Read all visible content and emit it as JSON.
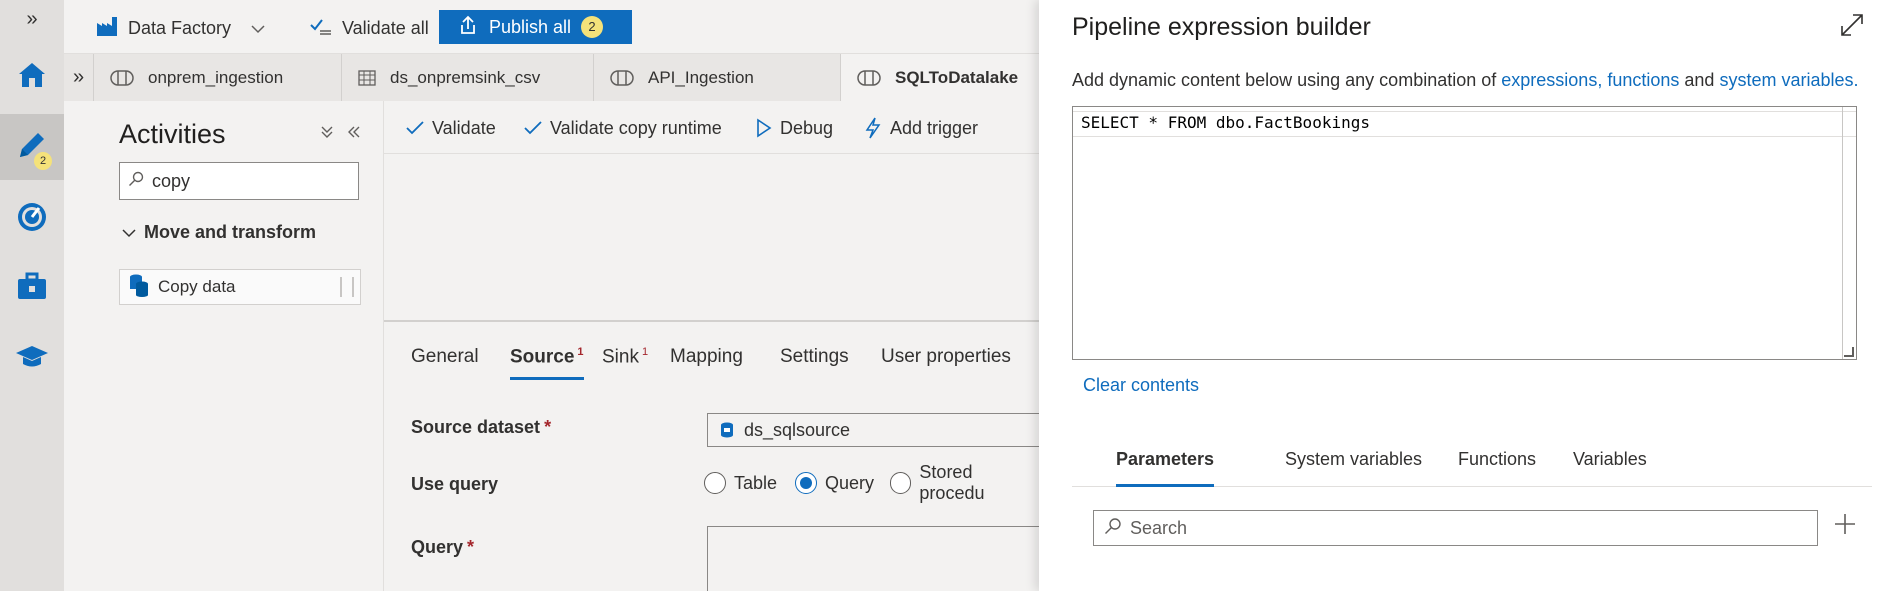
{
  "rail": {
    "expand_glyph": "»",
    "items": [
      {
        "icon": "home-icon"
      },
      {
        "icon": "pencil-author-icon",
        "badge": "2"
      },
      {
        "icon": "monitor-gauge-icon"
      },
      {
        "icon": "toolbox-manage-icon"
      },
      {
        "icon": "learning-cap-icon"
      }
    ]
  },
  "toolbar": {
    "factory_label": "Data Factory",
    "validate_all_label": "Validate all",
    "publish_all_label": "Publish all",
    "publish_count": "2"
  },
  "file_tabs": {
    "collapse_glyph": "»",
    "tabs": [
      {
        "label": "onprem_ingestion",
        "icon": "pipeline-icon"
      },
      {
        "label": "ds_onpremsink_csv",
        "icon": "table-dataset-icon"
      },
      {
        "label": "API_Ingestion",
        "icon": "pipeline-icon"
      },
      {
        "label": "SQLToDatalake",
        "icon": "pipeline-icon",
        "active": true
      }
    ]
  },
  "activities": {
    "title": "Activities",
    "search_value": "copy",
    "group_label": "Move and transform",
    "item_label": "Copy data"
  },
  "commands": {
    "validate": "Validate",
    "validate_copy_runtime": "Validate copy runtime",
    "debug": "Debug",
    "add_trigger": "Add trigger"
  },
  "properties": {
    "tabs": [
      {
        "label": "General"
      },
      {
        "label": "Source",
        "marker": "1",
        "active": true
      },
      {
        "label": "Sink",
        "marker": "1"
      },
      {
        "label": "Mapping"
      },
      {
        "label": "Settings"
      },
      {
        "label": "User properties"
      }
    ],
    "source_dataset_label": "Source dataset",
    "required_mark": "*",
    "source_dataset_value": "ds_sqlsource",
    "use_query_label": "Use query",
    "options": [
      "Table",
      "Query",
      "Stored procedu"
    ],
    "selected_option": "Query",
    "query_label": "Query"
  },
  "builder": {
    "title": "Pipeline expression builder",
    "desc_prefix": "Add dynamic content below using any combination of ",
    "link_expressions": "expressions,",
    "link_functions": "functions",
    "desc_and": " and ",
    "link_system_variables": "system variables.",
    "expression_value": "SELECT * FROM dbo.FactBookings",
    "clear_label": "Clear contents",
    "tabs": [
      {
        "label": "Parameters",
        "active": true
      },
      {
        "label": "System variables"
      },
      {
        "label": "Functions"
      },
      {
        "label": "Variables"
      }
    ],
    "search_placeholder": "Search"
  },
  "colors": {
    "accent": "#0f6cbd",
    "badge": "#f5e27a",
    "required": "#a4262c"
  }
}
